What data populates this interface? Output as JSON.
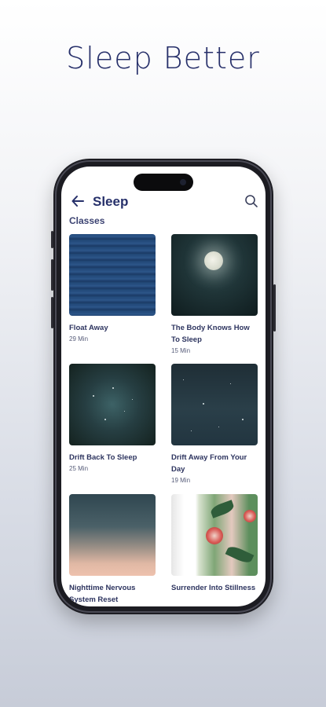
{
  "headline": "Sleep Better",
  "header": {
    "title": "Sleep"
  },
  "section_label": "Classes",
  "classes": [
    {
      "title": "Float Away",
      "duration": "29 Min"
    },
    {
      "title": "The Body Knows How To Sleep",
      "duration": "15 Min"
    },
    {
      "title": "Drift Back To Sleep",
      "duration": "25 Min"
    },
    {
      "title": "Drift Away From Your Day",
      "duration": "19 Min"
    },
    {
      "title": "Nighttime Nervous System Reset",
      "duration": ""
    },
    {
      "title": "Surrender Into Stillness",
      "duration": ""
    }
  ],
  "colors": {
    "accent": "#26306a",
    "text": "#2d345f"
  },
  "icons": [
    "back-arrow-icon",
    "search-icon"
  ]
}
